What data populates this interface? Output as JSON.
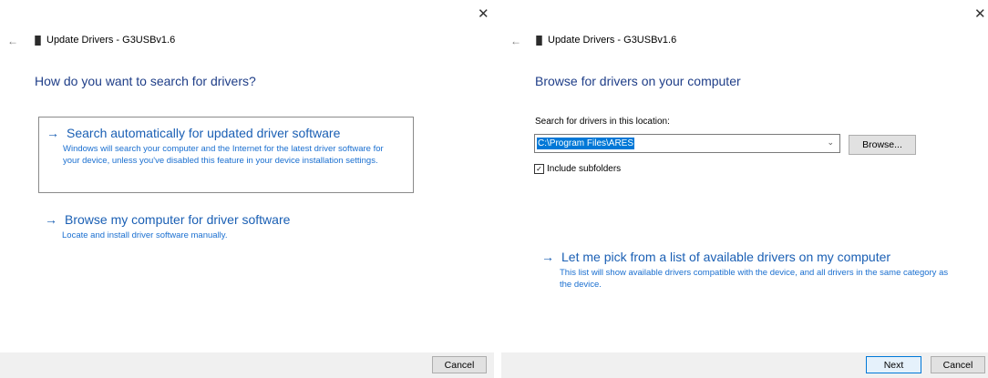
{
  "left_dialog": {
    "close_glyph": "✕",
    "back_glyph": "←",
    "window_title": "Update Drivers - G3USBv1.6",
    "heading": "How do you want to search for drivers?",
    "options": [
      {
        "arrow": "→",
        "title": "Search automatically for updated driver software",
        "description": "Windows will search your computer and the Internet for the latest driver software for your device, unless you've disabled this feature in your device installation settings."
      },
      {
        "arrow": "→",
        "title": "Browse my computer for driver software",
        "description": "Locate and install driver software manually."
      }
    ],
    "cancel_label": "Cancel"
  },
  "right_dialog": {
    "close_glyph": "✕",
    "back_glyph": "←",
    "window_title": "Update Drivers - G3USBv1.6",
    "heading": "Browse for drivers on your computer",
    "location_label": "Search for drivers in this location:",
    "path_value": "C:\\Program Files\\ARES",
    "browse_label": "Browse...",
    "include_subfolders_label": "Include subfolders",
    "include_subfolders_checked": true,
    "check_glyph": "✓",
    "chevron_glyph": "⌄",
    "pick_option": {
      "arrow": "→",
      "title": "Let me pick from a list of available drivers on my computer",
      "description": "This list will show available drivers compatible with the device, and all drivers in the same category as the device."
    },
    "next_label": "Next",
    "cancel_label": "Cancel"
  },
  "icons": {
    "device": "usb-device-icon",
    "back": "back-arrow-icon",
    "close": "close-icon",
    "arrow": "right-arrow-icon",
    "check": "checkmark-icon",
    "chevron": "chevron-down-icon"
  },
  "colors": {
    "link_blue": "#1a5fb4",
    "heading_blue": "#1f3e88",
    "selection_blue": "#0078d7",
    "footer_gray": "#f0f0f0"
  }
}
